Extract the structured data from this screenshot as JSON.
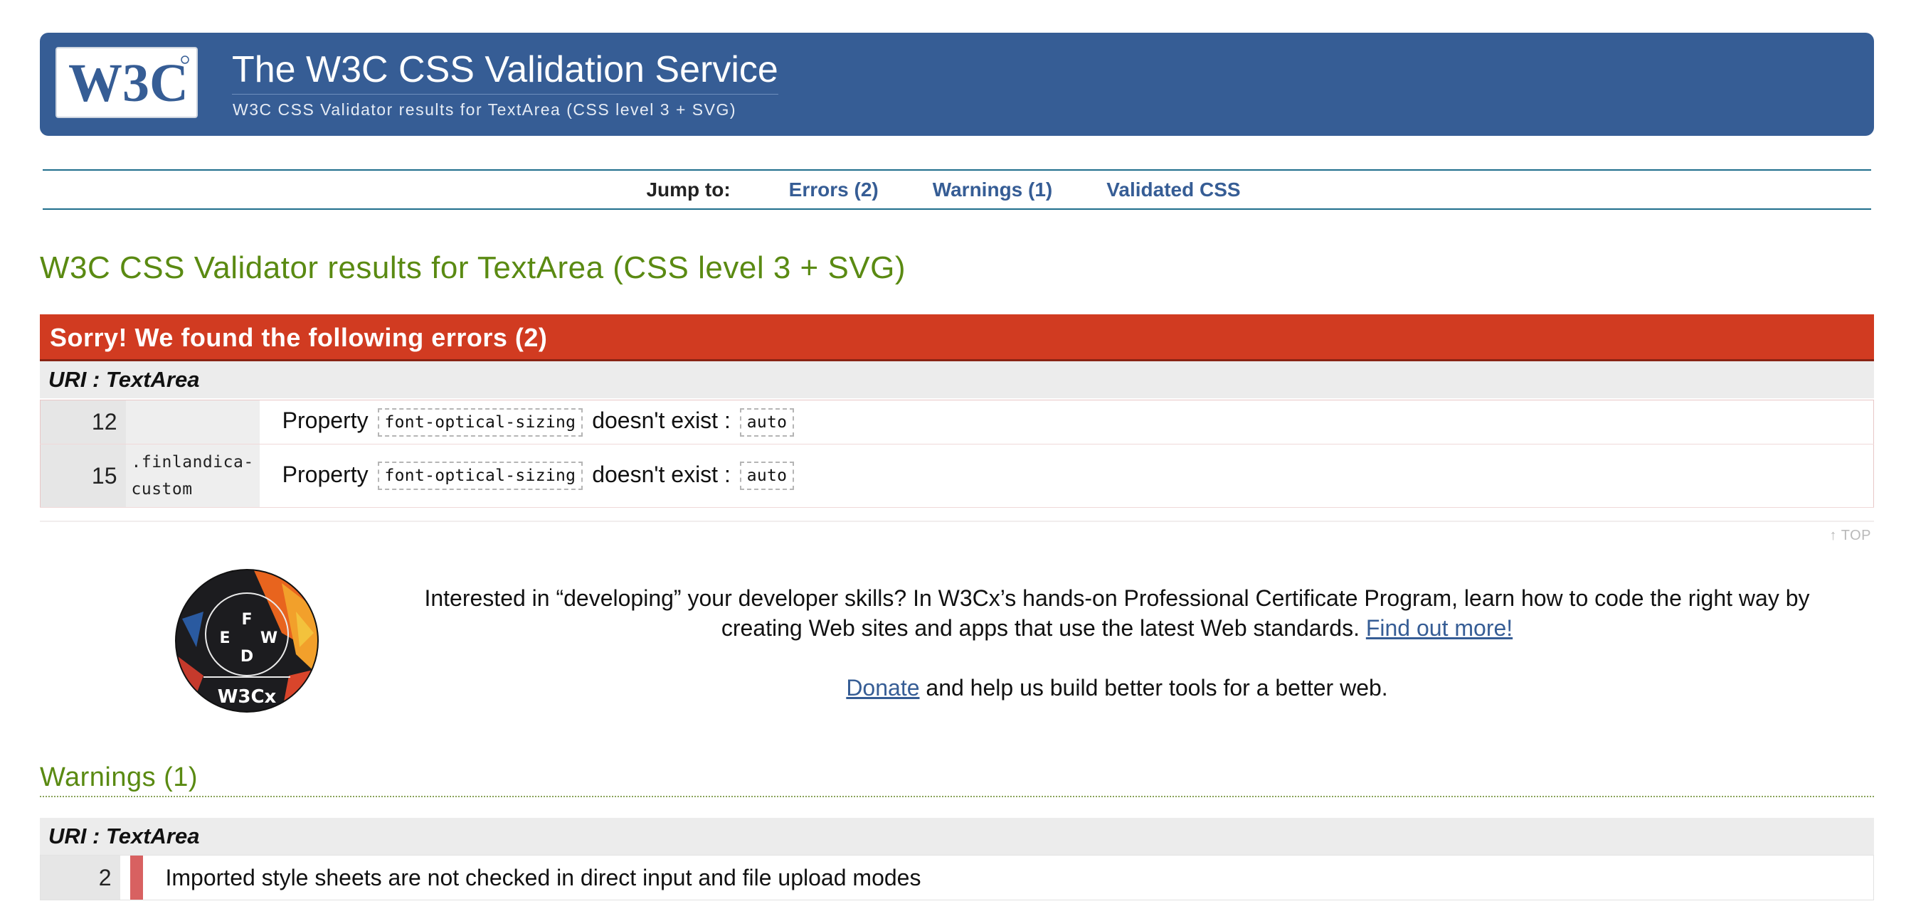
{
  "banner": {
    "title": "The W3C CSS Validation Service",
    "subtitle": "W3C CSS Validator results for TextArea (CSS level 3 + SVG)",
    "logo_text": "W3C"
  },
  "jump": {
    "label": "Jump to:",
    "links": [
      "Errors (2)",
      "Warnings (1)",
      "Validated CSS"
    ]
  },
  "heading": "W3C CSS Validator results for TextArea (CSS level 3 + SVG)",
  "errors": {
    "title": "Sorry! We found the following errors (2)",
    "uri": "URI : TextArea",
    "rows": [
      {
        "line": "12",
        "context": "",
        "prefix": "Property",
        "property": "font-optical-sizing",
        "middle": "doesn't exist :",
        "value": "auto"
      },
      {
        "line": "15",
        "context": ".finlandica-custom",
        "prefix": "Property",
        "property": "font-optical-sizing",
        "middle": "doesn't exist :",
        "value": "auto"
      }
    ]
  },
  "top_link": "↑ TOP",
  "promo": {
    "text": "Interested in “developing” your developer skills? In W3Cx’s hands-on Professional Certificate Program, learn how to code the right way by creating Web sites and apps that use the latest Web standards.",
    "link": "Find out more!",
    "donate_link": "Donate",
    "donate_text": "and help us build better tools for a better web.",
    "badge_text": "W3Cx"
  },
  "warnings": {
    "title": "Warnings (1)",
    "uri": "URI : TextArea",
    "rows": [
      {
        "line": "2",
        "message": "Imported style sheets are not checked in direct input and file upload modes"
      }
    ]
  },
  "colors": {
    "banner": "#365d95",
    "error": "#d13b21",
    "heading": "#5a8a12",
    "link": "#365d95",
    "warning_mark": "#d86161"
  }
}
